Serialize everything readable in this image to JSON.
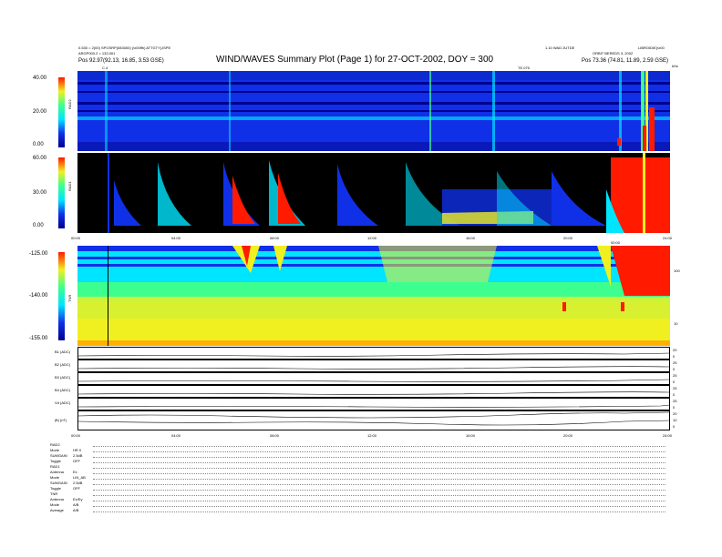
{
  "header": {
    "title": "WIND/WAVES Summary Plot (Page 1) for 27-OCT-2002, DOY = 300",
    "top_left_line1": "0.530 = 2(00) SPOSRP(083000) (\\x00ffh)  ATTGTY(JSPE",
    "top_left_line2": "ARGP000.2 = 133.001",
    "pos_left": "Pos    92.97(92.13, 16.85, 3.53 GSE)",
    "top_right_line1": "LIBROIDIE(\\x00",
    "top_right_line2": "ORBIT BEREDS 3, 2002",
    "pos_right": "Pos    73.36 (74.81, 11.89, 2.59 GSE)",
    "top_center_right": "1.10 WAD 2UTDE",
    "marker_left": "C.4",
    "marker_right": "TE.075",
    "corner_label": "kHz"
  },
  "colors": {
    "black": "#000000",
    "navy": "#00008f",
    "blue": "#1030e8",
    "cyan": "#00e5ff",
    "green": "#3cff8f",
    "yellow": "#f0f020",
    "red": "#ff1a00"
  },
  "chart_data": [
    {
      "type": "heatmap",
      "panel": "RAD2",
      "ylabel": "RAD2",
      "yticks": [
        "40.00",
        "20.00",
        "0.00"
      ],
      "ylim": [
        0,
        40
      ],
      "x_range_hours": [
        0,
        24
      ]
    },
    {
      "type": "heatmap",
      "panel": "RAD1",
      "ylabel": "RAD1",
      "yticks": [
        "60.00",
        "30.00",
        "0.00"
      ],
      "ylim": [
        0,
        60
      ],
      "x_range_hours": [
        0,
        24
      ],
      "xticks": [
        "00:00",
        "04:00",
        "08:00",
        "12:00",
        "16:00",
        "20:00",
        "24:00"
      ]
    },
    {
      "type": "heatmap",
      "panel": "TNR",
      "ylabel": "TNR",
      "yticks": [
        "-125.00",
        "-140.00",
        "-155.00"
      ],
      "right_ticks": [
        "100",
        "10"
      ],
      "ylim": [
        -155,
        -125
      ],
      "x_range_hours": [
        0,
        24
      ],
      "top_right_label": "00:00"
    },
    {
      "type": "line",
      "panels": [
        {
          "label": "B1 (ADC)",
          "right_ticks": [
            "20",
            "0"
          ]
        },
        {
          "label": "B2 (ADC)",
          "right_ticks": [
            "25",
            "0"
          ]
        },
        {
          "label": "B3 (ADC)",
          "right_ticks": [
            "25",
            "0"
          ]
        },
        {
          "label": "B4 (ADC)",
          "right_ticks": [
            "25",
            "0"
          ]
        },
        {
          "label": "Vd (ADC)",
          "right_ticks": [
            "25",
            "0"
          ]
        },
        {
          "label": "|B| (nT)",
          "right_ticks": [
            "20",
            "10",
            "0"
          ]
        }
      ],
      "xticks": [
        "00:00",
        "04:00",
        "08:00",
        "12:00",
        "16:00",
        "20:00",
        "24:00"
      ]
    }
  ],
  "footer": {
    "rows": [
      {
        "key": "RAD2",
        "val": ""
      },
      {
        "key": "Mode",
        "val": "HR 0"
      },
      {
        "key": "SUMGAIN",
        "val": "2.5dB"
      },
      {
        "key": "Toggle",
        "val": "OFF"
      },
      {
        "key": "RAD1",
        "val": ""
      },
      {
        "key": "Antenna",
        "val": "Ex"
      },
      {
        "key": "Mode",
        "val": "LIN_AB"
      },
      {
        "key": "SUMGAIN",
        "val": "2.5dB"
      },
      {
        "key": "Toggle",
        "val": "OFF"
      },
      {
        "key": "TNR",
        "val": ""
      },
      {
        "key": "Antenna",
        "val": "Ex/Ey"
      },
      {
        "key": "Mode",
        "val": "A/B"
      },
      {
        "key": "Average",
        "val": "A/B"
      }
    ]
  }
}
